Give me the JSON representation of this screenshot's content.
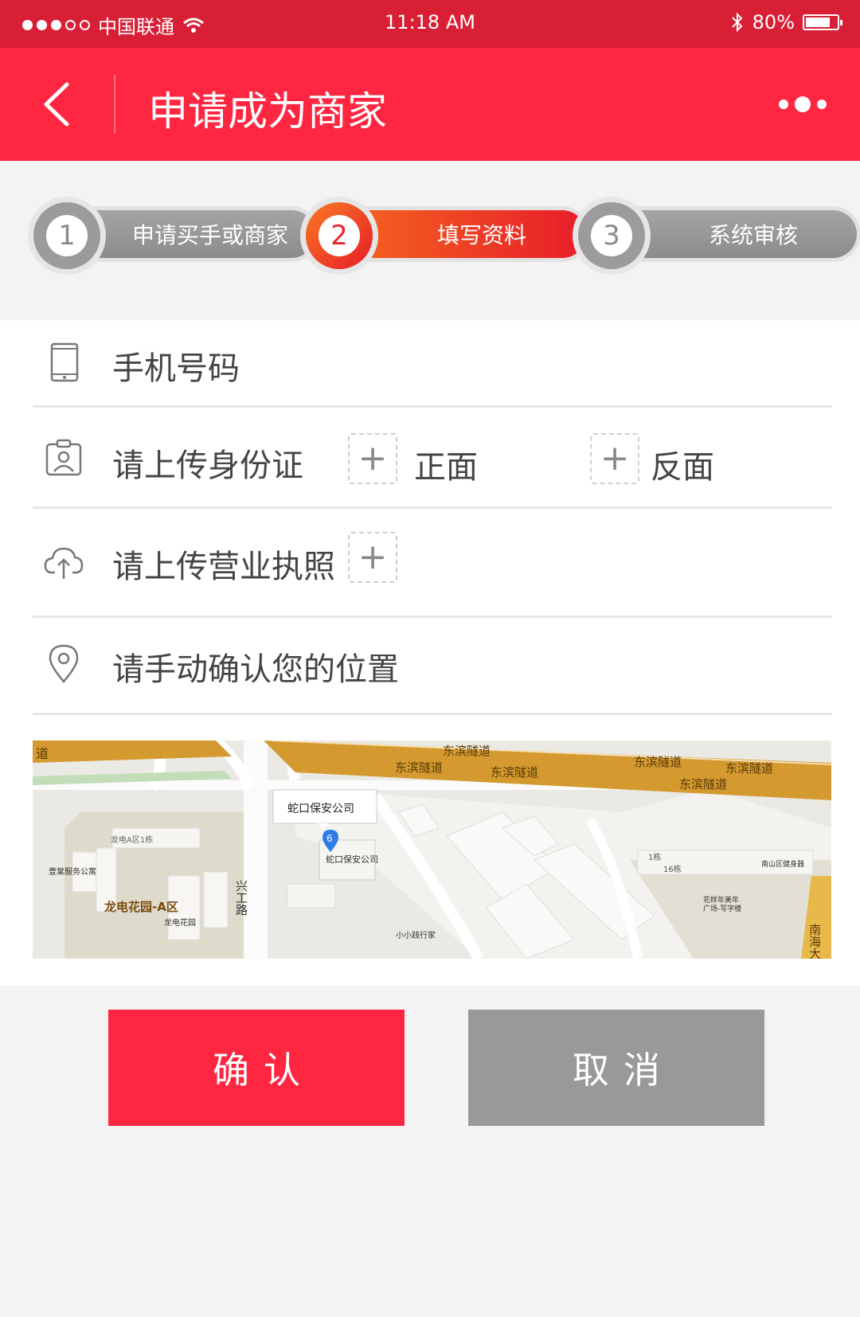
{
  "status_bar": {
    "carrier": "中国联通",
    "time": "11:18 AM",
    "battery_text": "80%",
    "battery_level": 0.8
  },
  "nav": {
    "title": "申请成为商家",
    "back_icon": "chevron-left-icon",
    "more_icon": "more-dots-icon"
  },
  "steps": [
    {
      "number": "1",
      "label": "申请买手或商家",
      "active": false
    },
    {
      "number": "2",
      "label": "填写资料",
      "active": true
    },
    {
      "number": "3",
      "label": "系统审核",
      "active": false
    }
  ],
  "form": {
    "phone": {
      "label": "手机号码",
      "icon": "phone-icon"
    },
    "id_card": {
      "label": "请上传身份证",
      "icon": "id-card-icon",
      "front": "正面",
      "back": "反面",
      "plus": "+"
    },
    "license": {
      "label": "请上传营业执照",
      "icon": "cloud-upload-icon",
      "plus": "+"
    },
    "location": {
      "label": "请手动确认您的位置",
      "icon": "location-pin-icon"
    }
  },
  "map": {
    "labels": {
      "road_top_left": "道",
      "tunnel_1": "东滨隧道",
      "tunnel_2": "东滨隧道",
      "tunnel_3": "东滨隧道",
      "tunnel_4": "东滨隧道",
      "tunnel_5": "东滨隧道",
      "tunnel_6": "东滨隧道",
      "callout": "蛇口保安公司",
      "marker_number": "6",
      "poi_security": "蛇口保安公司",
      "building_a1": "龙电A区1栋",
      "service_apartment": "壹棠服务公寓",
      "garden_a": "龙电花园-A区",
      "garden": "龙电花园",
      "road_xinggong": "兴工路",
      "xiaoxiao": "小小践行家",
      "b1": "1栋",
      "b16": "16栋",
      "fitness": "南山区健身器",
      "huaxiang_1": "花样年美年",
      "huaxiang_2": "广场-写字楼",
      "nanhai": "南海大"
    }
  },
  "buttons": {
    "confirm": "确认",
    "cancel": "取消"
  },
  "colors": {
    "brand_red": "#fe2641",
    "status_bar_red": "#d81f36",
    "cancel_gray": "#999999",
    "road_gold": "#d4992f"
  }
}
